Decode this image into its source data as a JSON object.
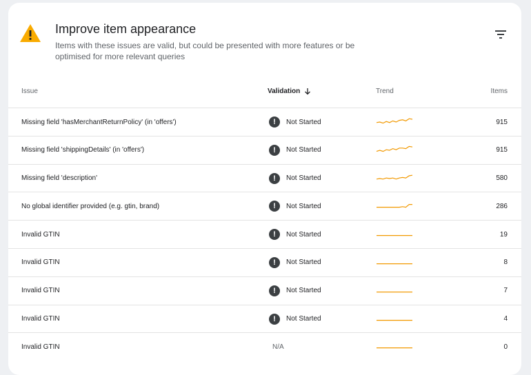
{
  "header": {
    "title": "Improve item appearance",
    "subtitle": "Items with these issues are valid, but could be presented with more features or be optimised for more relevant queries",
    "warning_icon": "warning-triangle-icon",
    "filter_icon": "filter-list-icon"
  },
  "columns": {
    "issue": "Issue",
    "validation": "Validation",
    "trend": "Trend",
    "items": "Items"
  },
  "colors": {
    "warning": "#f9ab00",
    "trend_line": "#f29900",
    "status_icon": "#3c4043"
  },
  "rows": [
    {
      "issue": "Missing field 'hasMerchantReturnPolicy' (in 'offers')",
      "validation": "Not Started",
      "items": "915",
      "trend": [
        0.55,
        0.5,
        0.6,
        0.45,
        0.55,
        0.4,
        0.5,
        0.35,
        0.3,
        0.4,
        0.2,
        0.25
      ]
    },
    {
      "issue": "Missing field 'shippingDetails' (in 'offers')",
      "validation": "Not Started",
      "items": "915",
      "trend": [
        0.6,
        0.5,
        0.6,
        0.45,
        0.5,
        0.35,
        0.45,
        0.3,
        0.3,
        0.35,
        0.15,
        0.2
      ]
    },
    {
      "issue": "Missing field 'description'",
      "validation": "Not Started",
      "items": "580",
      "trend": [
        0.55,
        0.5,
        0.55,
        0.45,
        0.5,
        0.45,
        0.55,
        0.45,
        0.4,
        0.45,
        0.25,
        0.2
      ]
    },
    {
      "issue": "No global identifier provided (e.g. gtin, brand)",
      "validation": "Not Started",
      "items": "286",
      "trend": [
        0.6,
        0.6,
        0.6,
        0.6,
        0.6,
        0.6,
        0.6,
        0.6,
        0.55,
        0.6,
        0.35,
        0.35
      ]
    },
    {
      "issue": "Invalid GTIN",
      "validation": "Not Started",
      "items": "19",
      "trend": [
        0.6,
        0.6,
        0.6,
        0.6,
        0.6,
        0.6,
        0.6,
        0.6,
        0.6,
        0.6,
        0.6,
        0.6
      ]
    },
    {
      "issue": "Invalid GTIN",
      "validation": "Not Started",
      "items": "8",
      "trend": [
        0.6,
        0.6,
        0.6,
        0.6,
        0.6,
        0.6,
        0.6,
        0.6,
        0.6,
        0.6,
        0.6,
        0.6
      ]
    },
    {
      "issue": "Invalid GTIN",
      "validation": "Not Started",
      "items": "7",
      "trend": [
        0.6,
        0.6,
        0.6,
        0.6,
        0.6,
        0.6,
        0.6,
        0.6,
        0.6,
        0.6,
        0.6,
        0.6
      ]
    },
    {
      "issue": "Invalid GTIN",
      "validation": "Not Started",
      "items": "4",
      "trend": [
        0.6,
        0.6,
        0.6,
        0.6,
        0.6,
        0.6,
        0.6,
        0.6,
        0.6,
        0.6,
        0.6,
        0.6
      ]
    },
    {
      "issue": "Invalid GTIN",
      "validation": "N/A",
      "items": "0",
      "trend": [
        0.6,
        0.6,
        0.6,
        0.6,
        0.6,
        0.6,
        0.6,
        0.6,
        0.6,
        0.6,
        0.6,
        0.6
      ]
    }
  ]
}
